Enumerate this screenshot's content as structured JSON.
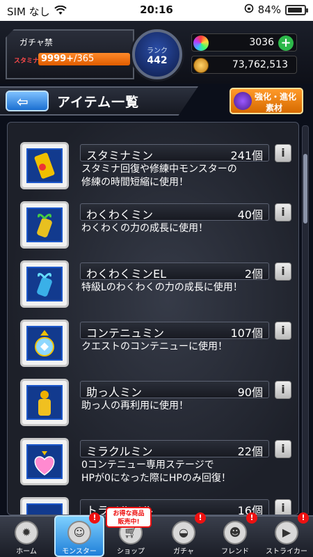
{
  "status_bar": {
    "carrier": "SIM なし",
    "time": "20:16",
    "battery": "84%"
  },
  "player": {
    "name": "ガチャ禁",
    "stamina_label": "スタミナ",
    "stamina_current": "9999+",
    "stamina_max": "/365",
    "rank_label": "ランク",
    "rank_value": "442"
  },
  "currency": {
    "orbs": "3036",
    "gold": "73,762,513"
  },
  "title_bar": {
    "page_title": "アイテム一覧",
    "evolve_line1": "強化・進化",
    "evolve_line2": "素材"
  },
  "items": [
    {
      "name": "スタミナミン",
      "count": "241個",
      "desc": "スタミナ回復や修練中モンスターの\n修練の時間短縮に使用！"
    },
    {
      "name": "わくわくミン",
      "count": "40個",
      "desc": "わくわくの力の成長に使用！"
    },
    {
      "name": "わくわくミンEL",
      "count": "2個",
      "desc": "特級Lのわくわくの力の成長に使用！"
    },
    {
      "name": "コンテニュミン",
      "count": "107個",
      "desc": "クエストのコンテニューに使用！"
    },
    {
      "name": "助っ人ミン",
      "count": "90個",
      "desc": "助っ人の再利用に使用！"
    },
    {
      "name": "ミラクルミン",
      "count": "22個",
      "desc": "0コンテニュー専用ステージで\nHPが0になった際にHPのみ回復！"
    },
    {
      "name": "トラベルベル",
      "count": "16個",
      "desc": ""
    }
  ],
  "bottom_nav": {
    "home": "ホーム",
    "monster": "モンスター",
    "shop": "ショップ",
    "gacha": "ガチャ",
    "friend": "フレンド",
    "striker": "ストライカー",
    "shop_popup": "お得な商品\n販売中!"
  },
  "colors": {
    "accent_blue": "#1f7fd8",
    "stamina_orange": "#ff8a2a",
    "badge_red": "#e11111"
  }
}
